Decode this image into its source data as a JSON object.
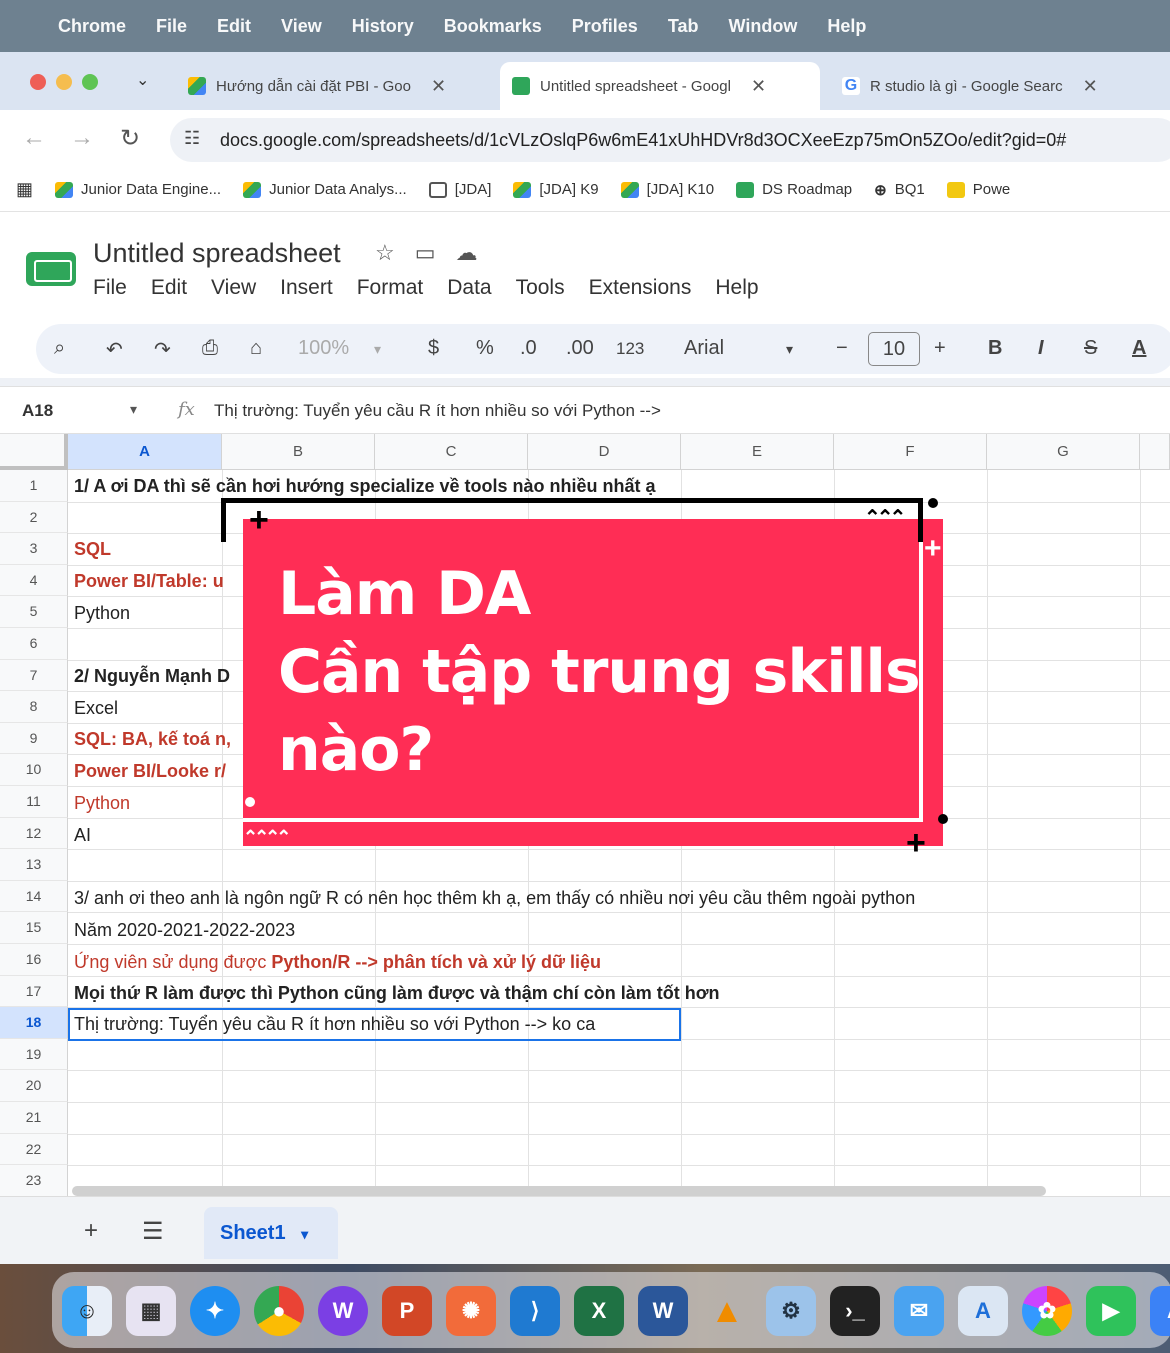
{
  "mac_menu": [
    "Chrome",
    "File",
    "Edit",
    "View",
    "History",
    "Bookmarks",
    "Profiles",
    "Tab",
    "Window",
    "Help"
  ],
  "tabs": [
    {
      "title": "Hướng dẫn cài đặt PBI - Goo"
    },
    {
      "title": "Untitled spreadsheet - Googl"
    },
    {
      "title": "R studio là gì - Google Searc"
    }
  ],
  "url": "docs.google.com/spreadsheets/d/1cVLzOslqP6w6mE41xUhHDVr8d3OCXeeEzp75mOn5ZOo/edit?gid=0#",
  "bookmarks": [
    "Junior Data Engine...",
    "Junior Data Analys...",
    "[JDA]",
    "[JDA] K9",
    "[JDA] K10",
    "DS Roadmap",
    "BQ1",
    "Powe"
  ],
  "doc": {
    "title": "Untitled spreadsheet",
    "menu": [
      "File",
      "Edit",
      "View",
      "Insert",
      "Format",
      "Data",
      "Tools",
      "Extensions",
      "Help"
    ]
  },
  "toolbar": {
    "zoom": "100%",
    "currency": "$",
    "percent": "%",
    "dec_less": ".0",
    "dec_more": ".00",
    "format_123": "123",
    "font": "Arial",
    "font_size": "10",
    "bold": "B",
    "italic": "I",
    "text_color": "A"
  },
  "formula_bar": {
    "cell_ref": "A18",
    "fx": "fx",
    "content": "Thị trường: Tuyển yêu cầu R ít hơn nhiều so với Python -->"
  },
  "columns": [
    "A",
    "B",
    "C",
    "D",
    "E",
    "F",
    "G"
  ],
  "rows": [
    "1",
    "2",
    "3",
    "4",
    "5",
    "6",
    "7",
    "8",
    "9",
    "10",
    "11",
    "12",
    "13",
    "14",
    "15",
    "16",
    "17",
    "18",
    "19",
    "20",
    "21",
    "22",
    "23"
  ],
  "cells": {
    "r1": "1/ A ơi DA thì sẽ cần hơi hướng specialize về tools nào nhiều nhất ạ",
    "r3": "SQL",
    "r4": "Power BI/Table: u",
    "r5": "Python",
    "r7": "2/ Nguyễn Mạnh D",
    "r8": "Excel",
    "r9": "SQL: BA, kế toá n,",
    "r10": "Power BI/Looke r/",
    "r11": "Python",
    "r12": "AI",
    "r14": "3/ anh ơi theo anh là ngôn ngữ R có nên học thêm kh ạ, em thấy có nhiều nơi yêu cầu thêm ngoài python",
    "r15": "Năm 2020-2021-2022-2023",
    "r16_a": "Ứng viên sử dụng được ",
    "r16_b": "Python/R --> phân tích và xử lý dữ liệu",
    "r17": "Mọi thứ R làm được thì Python cũng làm được và thậm chí còn làm tốt hơn",
    "r18": "Thị trường: Tuyển yêu cầu R ít hơn nhiều so với Python --> ko ca"
  },
  "sheet_tab": "Sheet1",
  "promo": {
    "line1": "Làm DA",
    "line2": "Cần tập trung skills",
    "line3": "nào?"
  },
  "colors": {
    "promo_bg": "#ff2d55",
    "sheets_green": "#2fa65a",
    "selection_blue": "#1a73e8",
    "red_text": "#c0392b"
  }
}
